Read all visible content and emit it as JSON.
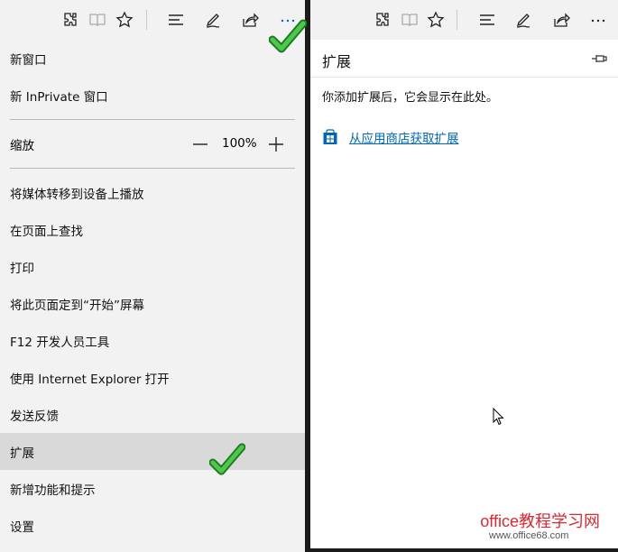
{
  "toolbar": {
    "icons": [
      "extensions-icon",
      "reading-view-icon",
      "favorite-star-icon",
      "hub-icon",
      "web-note-icon",
      "share-icon",
      "more-icon"
    ]
  },
  "menu": {
    "items": [
      {
        "label": "新窗口"
      },
      {
        "label": "新 InPrivate 窗口"
      }
    ],
    "zoom": {
      "label": "缩放",
      "value": "100%"
    },
    "items2": [
      {
        "label": "将媒体转移到设备上播放"
      },
      {
        "label": "在页面上查找"
      },
      {
        "label": "打印"
      },
      {
        "label": "将此页面定到“开始”屏幕"
      },
      {
        "label": "F12 开发人员工具"
      },
      {
        "label": "使用 Internet Explorer 打开"
      },
      {
        "label": "发送反馈"
      },
      {
        "label": "扩展",
        "active": true
      },
      {
        "label": "新增功能和提示"
      },
      {
        "label": "设置"
      }
    ]
  },
  "extensions_pane": {
    "title": "扩展",
    "message": "你添加扩展后，它会显示在此处。",
    "store_link": "从应用商店获取扩展"
  },
  "watermark": {
    "text": "office教程学习网",
    "url": "www.office68.com"
  },
  "colors": {
    "menu_bg": "#f2f2f2",
    "active_bg": "#d9d9d9",
    "link": "#0067b8",
    "check": "#2e9e2e",
    "watermark": "#e3262d"
  }
}
